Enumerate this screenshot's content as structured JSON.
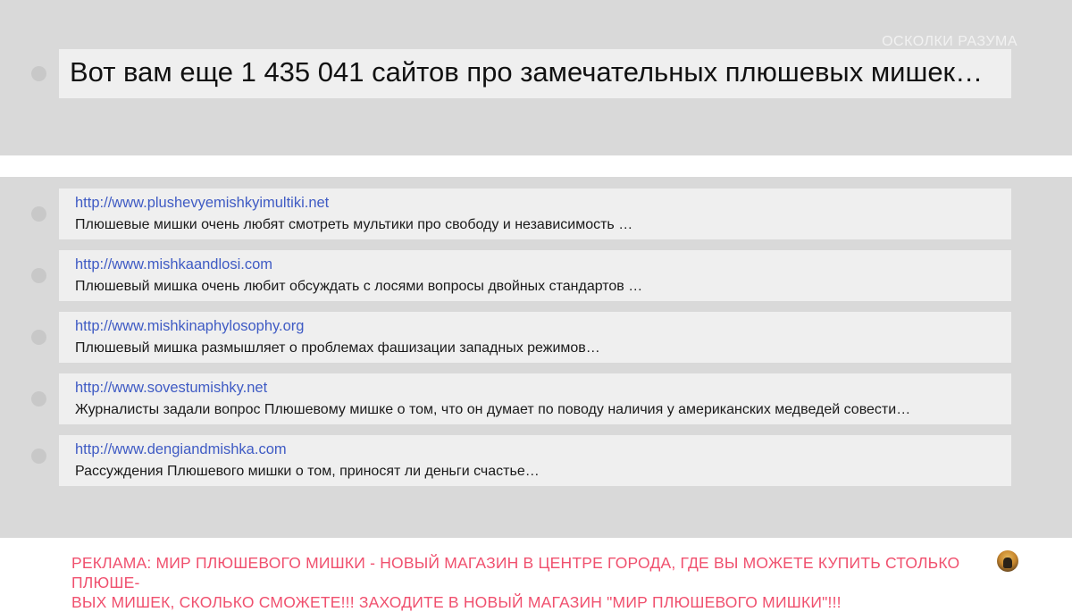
{
  "watermark": "ОСКОЛКИ РАЗУМА",
  "headline": "Вот вам еще 1 435 041 сайтов про замечательных плюшевых мишек…",
  "results": [
    {
      "url": "http://www.plushevyemishkyimultiki.net",
      "description": "Плюшевые мишки очень любят смотреть мультики про свободу и независимость …"
    },
    {
      "url": "http://www.mishkaandlosi.com",
      "description": "Плюшевый мишка очень любит обсуждать с лосями вопросы двойных стандартов …"
    },
    {
      "url": "http://www.mishkinaphylosophy.org",
      "description": "Плюшевый мишка размышляет о проблемах фашизации западных режимов…"
    },
    {
      "url": "http://www.sovestumishky.net",
      "description": "Журналисты задали вопрос Плюшевому мишке о том, что он думает по поводу наличия у американских медведей совести…"
    },
    {
      "url": "http://www.dengiandmishka.com",
      "description": "Рассуждения Плюшевого мишки о том, приносят ли деньги счастье…"
    }
  ],
  "ad": {
    "line1": "РЕКЛАМА: МИР ПЛЮШЕВОГО МИШКИ - НОВЫЙ МАГАЗИН В ЦЕНТРЕ ГОРОДА, ГДЕ ВЫ МОЖЕТЕ КУПИТЬ СТОЛЬКО ПЛЮШЕ-",
    "line2": "ВЫХ МИШЕК, СКОЛЬКО СМОЖЕТЕ!!! ЗАХОДИТЕ В НОВЫЙ МАГАЗИН \"МИР ПЛЮШЕВОГО МИШКИ\"!!!"
  },
  "colors": {
    "background_band": "#d9d9d9",
    "card": "#efefef",
    "link": "#3f5bc4",
    "ad_text": "#f0506e"
  }
}
